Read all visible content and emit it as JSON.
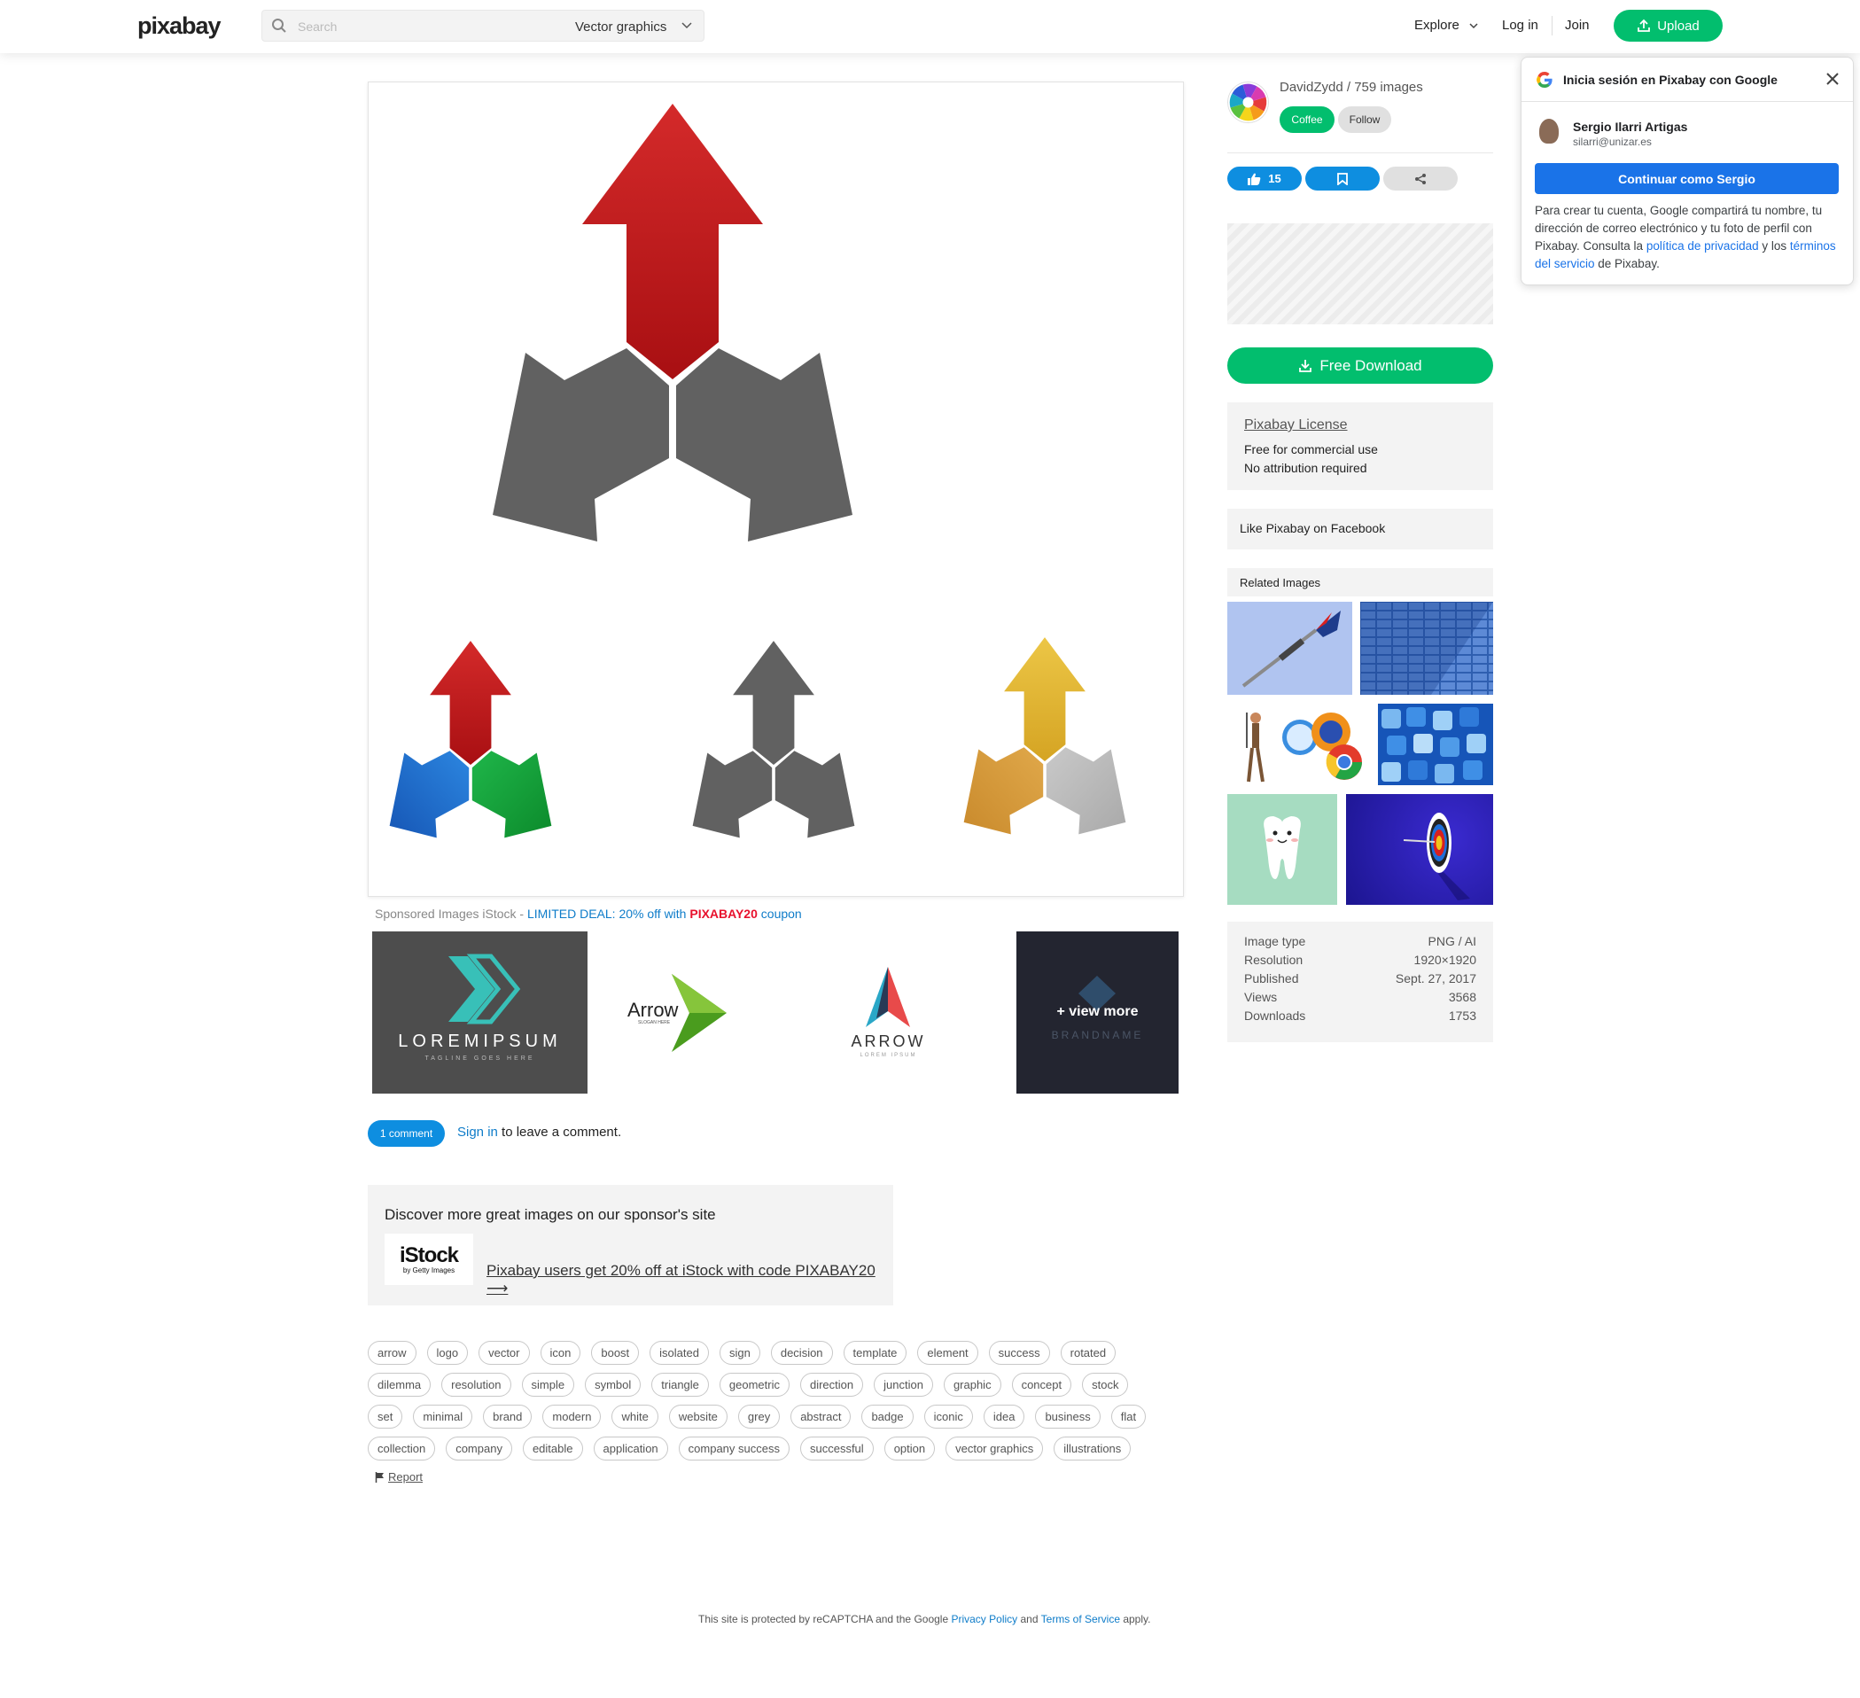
{
  "header": {
    "logo": "pixabay",
    "search_placeholder": "Search",
    "search_category": "Vector graphics",
    "nav": {
      "explore": "Explore",
      "login": "Log in",
      "join": "Join",
      "upload": "Upload"
    }
  },
  "main_image": {
    "colors": {
      "red": "#c0181c",
      "grey": "#616161",
      "blue": "#1e6fc9",
      "green": "#16a23a",
      "gold": "#e2b63a",
      "orange": "#d99a3c",
      "silver": "#bdbdbd"
    }
  },
  "sponsored": {
    "prefix": "Sponsored Images iStock - ",
    "deal": "LIMITED DEAL: 20% off with ",
    "code": "PIXABAY20",
    "suffix": " coupon",
    "tiles": [
      {
        "brand": "LOREMIPSUM",
        "tagline": "TAGLINE GOES HERE"
      },
      {
        "brand": "Arrow",
        "tagline": "SLOGAN HERE"
      },
      {
        "brand": "ARROW",
        "tagline": "LOREM IPSUM"
      },
      {
        "overlay": "+ view more",
        "brand": "BRANDNAME"
      }
    ]
  },
  "comments": {
    "count_label": "1 comment",
    "signin_link": "Sign in",
    "signin_suffix": " to leave a comment."
  },
  "sponsor_box": {
    "title": "Discover more great images on our sponsor's site",
    "logo_big": "iStock",
    "logo_small": "by Getty Images",
    "promo": "Pixabay users get 20% off at iStock with code PIXABAY20 ⟶"
  },
  "tags": [
    [
      "arrow",
      "logo",
      "vector",
      "icon",
      "boost",
      "isolated",
      "sign",
      "decision",
      "template",
      "element",
      "success",
      "rotated"
    ],
    [
      "dilemma",
      "resolution",
      "simple",
      "symbol",
      "triangle",
      "geometric",
      "direction",
      "junction",
      "graphic",
      "concept",
      "stock"
    ],
    [
      "set",
      "minimal",
      "brand",
      "modern",
      "white",
      "website",
      "grey",
      "abstract",
      "badge",
      "iconic",
      "idea",
      "business",
      "flat"
    ],
    [
      "collection",
      "company",
      "editable",
      "application",
      "company success",
      "successful",
      "option",
      "vector graphics",
      "illustrations"
    ]
  ],
  "report": "Report",
  "footer": {
    "prefix": "This site is protected by reCAPTCHA and the Google ",
    "privacy": "Privacy Policy",
    "and": " and ",
    "terms": "Terms of Service",
    "suffix": " apply."
  },
  "author": {
    "name": "DavidZydd",
    "images": "759 images",
    "separator": " / ",
    "coffee": "Coffee",
    "follow": "Follow"
  },
  "actions": {
    "likes": "15",
    "colors": {
      "blue": "#0e8ee0",
      "grey": "#e0e0e0"
    }
  },
  "download": {
    "label": "Free Download"
  },
  "license": {
    "title": "Pixabay License",
    "line1": "Free for commercial use",
    "line2": "No attribution required"
  },
  "facebook": "Like Pixabay on Facebook",
  "related": {
    "title": "Related Images"
  },
  "meta": {
    "rows": [
      {
        "label": "Image type",
        "value": "PNG / AI"
      },
      {
        "label": "Resolution",
        "value": "1920×1920"
      },
      {
        "label": "Published",
        "value": "Sept. 27, 2017"
      },
      {
        "label": "Views",
        "value": "3568"
      },
      {
        "label": "Downloads",
        "value": "1753"
      }
    ]
  },
  "google": {
    "title": "Inicia sesión en Pixabay con Google",
    "name": "Sergio Ilarri Artigas",
    "email": "silarri@unizar.es",
    "button": "Continuar como Sergio",
    "text_1": "Para crear tu cuenta, Google compartirá tu nombre, tu dirección de correo electrónico y tu foto de perfil con Pixabay. Consulta la ",
    "privacy": "política de privacidad",
    "text_2": " y los ",
    "terms": "términos del servicio",
    "text_3": " de Pixabay."
  },
  "brand_colors": {
    "green": "#02be6e",
    "blue": "#0e8ee0",
    "google_blue": "#1a73e8"
  }
}
